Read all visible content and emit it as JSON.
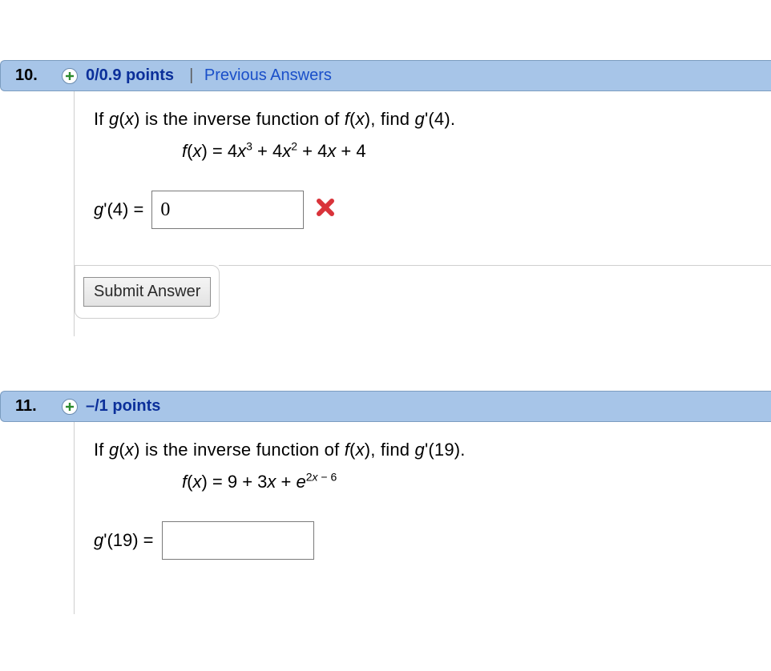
{
  "q10": {
    "number": "10.",
    "points": "0/0.9 points",
    "prev_link": "Previous Answers",
    "prompt_prefix": "If ",
    "prompt_g": "g",
    "prompt_paren1": "(",
    "prompt_x1": "x",
    "prompt_paren2": ")",
    "prompt_mid1": " is the inverse function of ",
    "prompt_f": "f",
    "prompt_paren3": "(",
    "prompt_x2": "x",
    "prompt_paren4": ")",
    "prompt_mid2": ", find  ",
    "prompt_g2": "g",
    "prompt_tick": "'(4).",
    "formula_f": "f",
    "formula_px": "(",
    "formula_x": "x",
    "formula_cx": ")",
    "formula_eq": " = 4",
    "formula_x3": "x",
    "formula_sup3": "3",
    "formula_p1": " + 4",
    "formula_x2": "x",
    "formula_sup2": "2",
    "formula_p2": " + 4",
    "formula_x1": "x",
    "formula_p3": " + 4",
    "answer_label_g": "g",
    "answer_label_rest": "'(4) =",
    "answer_value": "0",
    "submit_label": "Submit Answer"
  },
  "q11": {
    "number": "11.",
    "points": "–/1 points",
    "prompt_prefix": "If ",
    "prompt_g": "g",
    "prompt_paren1": "(",
    "prompt_x1": "x",
    "prompt_paren2": ")",
    "prompt_mid1": " is the inverse function of ",
    "prompt_f": "f",
    "prompt_paren3": "(",
    "prompt_x2": "x",
    "prompt_paren4": ")",
    "prompt_mid2": ", find  ",
    "prompt_g2": "g",
    "prompt_tick": "'(19).",
    "formula_f": "f",
    "formula_px": "(",
    "formula_x": "x",
    "formula_cx": ")",
    "formula_eq": " = 9 + 3",
    "formula_x3": "x",
    "formula_p1": " + ",
    "formula_e": "e",
    "formula_exp1": "2",
    "formula_expx": "x",
    "formula_exp2": " − 6",
    "answer_label_g": "g",
    "answer_label_rest": "'(19) =",
    "answer_value": ""
  }
}
